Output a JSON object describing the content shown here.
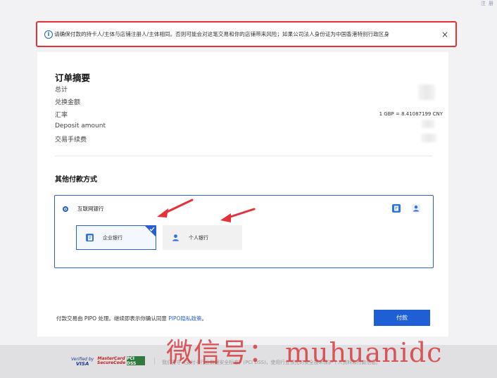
{
  "top_right": "注 册",
  "notice": {
    "text": "请确保付款的持卡人/主体与店铺注册人/主体相同。否则可能会对这笔交易和你的店铺带来风险；如果公司法人身份证为中国香港特别行政区身",
    "close": "×"
  },
  "summary": {
    "title": "订单摘要",
    "rows": [
      "总计",
      "兑换金额",
      "汇率",
      "Deposit amount",
      "交易手续费"
    ],
    "rate": "1 GBP = 8.41087199 CNY"
  },
  "other_methods": {
    "title": "其他付款方式",
    "method_label": "互联网银行",
    "options": [
      "企业银行",
      "个人银行"
    ]
  },
  "footer": {
    "text_prefix": "付款交易由 PIPO 处理。继续即表示你确认同意 ",
    "pipo": "PIPO",
    "privacy_link": "隐私政策",
    "text_suffix": "。",
    "pay_button": "付款"
  },
  "bottom": {
    "visa_top": "Verified by",
    "visa_bottom": "VISA",
    "mc_top": "MasterCard",
    "mc_bottom": "SecureCode",
    "pci": "PCI DSS",
    "security_text": "我们遵守《支付卡行业数据安全标准》(PCI DSS)，使用行业领先的安全技术保护个人资料和付款信息。"
  },
  "watermark": "微信号： muhuanidc",
  "colors": {
    "primary": "#1f5fd6",
    "highlight": "#e53238"
  }
}
